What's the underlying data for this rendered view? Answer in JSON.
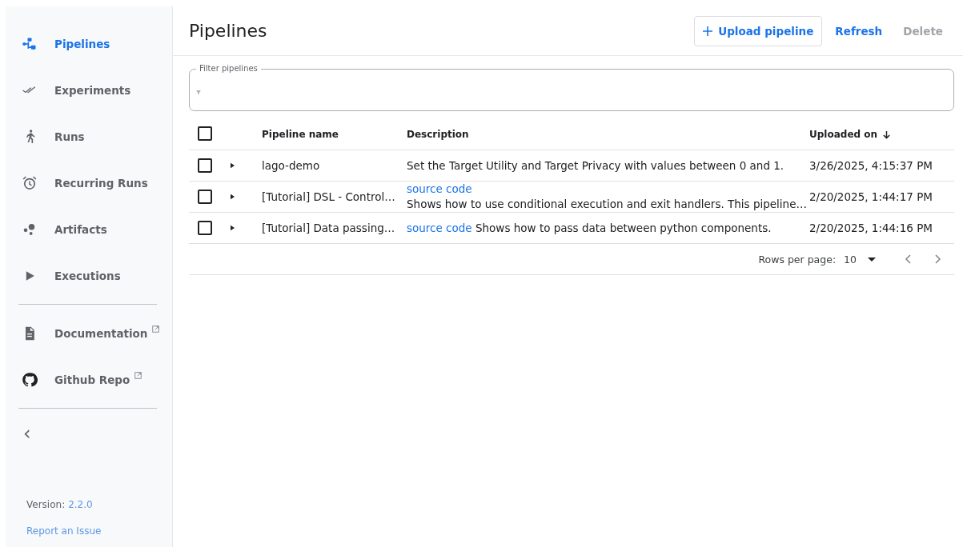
{
  "sidebar": {
    "items": [
      {
        "label": "Pipelines",
        "selected": true
      },
      {
        "label": "Experiments",
        "selected": false
      },
      {
        "label": "Runs",
        "selected": false
      },
      {
        "label": "Recurring Runs",
        "selected": false
      },
      {
        "label": "Artifacts",
        "selected": false
      },
      {
        "label": "Executions",
        "selected": false
      }
    ],
    "links": [
      {
        "label": "Documentation",
        "external": true
      },
      {
        "label": "Github Repo",
        "external": true
      }
    ],
    "collapse": "‹",
    "version_label": "Version:",
    "version": "2.2.0",
    "report_link": "Report an Issue"
  },
  "header": {
    "title": "Pipelines",
    "buttons": [
      {
        "label": "Upload pipeline",
        "kind": "outlined",
        "disabled": false
      },
      {
        "label": "Refresh",
        "kind": "text",
        "disabled": false
      },
      {
        "label": "Delete",
        "kind": "text",
        "disabled": true
      }
    ]
  },
  "filter": {
    "label": "Filter pipelines"
  },
  "table": {
    "select_all": {
      "checked": false
    },
    "columns": [
      {
        "label": "Pipeline name",
        "sorted": false
      },
      {
        "label": "Description",
        "sorted": false
      },
      {
        "label": "Uploaded on",
        "sorted": true
      }
    ],
    "rows": [
      {
        "checked": false,
        "expanded": false,
        "name": "lago-demo",
        "description": {
          "text": "Set the Target Utility and Target Privacy with values between 0 and 1."
        },
        "uploaded": "3/26/2025, 4:15:37 PM"
      },
      {
        "checked": false,
        "expanded": false,
        "name": "[Tutorial] DSL - Control…",
        "description": {
          "link": "source code",
          "link_own_line": true,
          "text": "Shows how to use conditional execution and exit handlers. This pipeline…"
        },
        "uploaded": "2/20/2025, 1:44:17 PM"
      },
      {
        "checked": false,
        "expanded": false,
        "name": "[Tutorial] Data passing…",
        "description": {
          "link": "source code",
          "link_own_line": false,
          "text": "Shows how to pass data between python components."
        },
        "uploaded": "2/20/2025, 1:44:16 PM"
      }
    ]
  },
  "pagination": {
    "label": "Rows per page:",
    "value": "10"
  }
}
